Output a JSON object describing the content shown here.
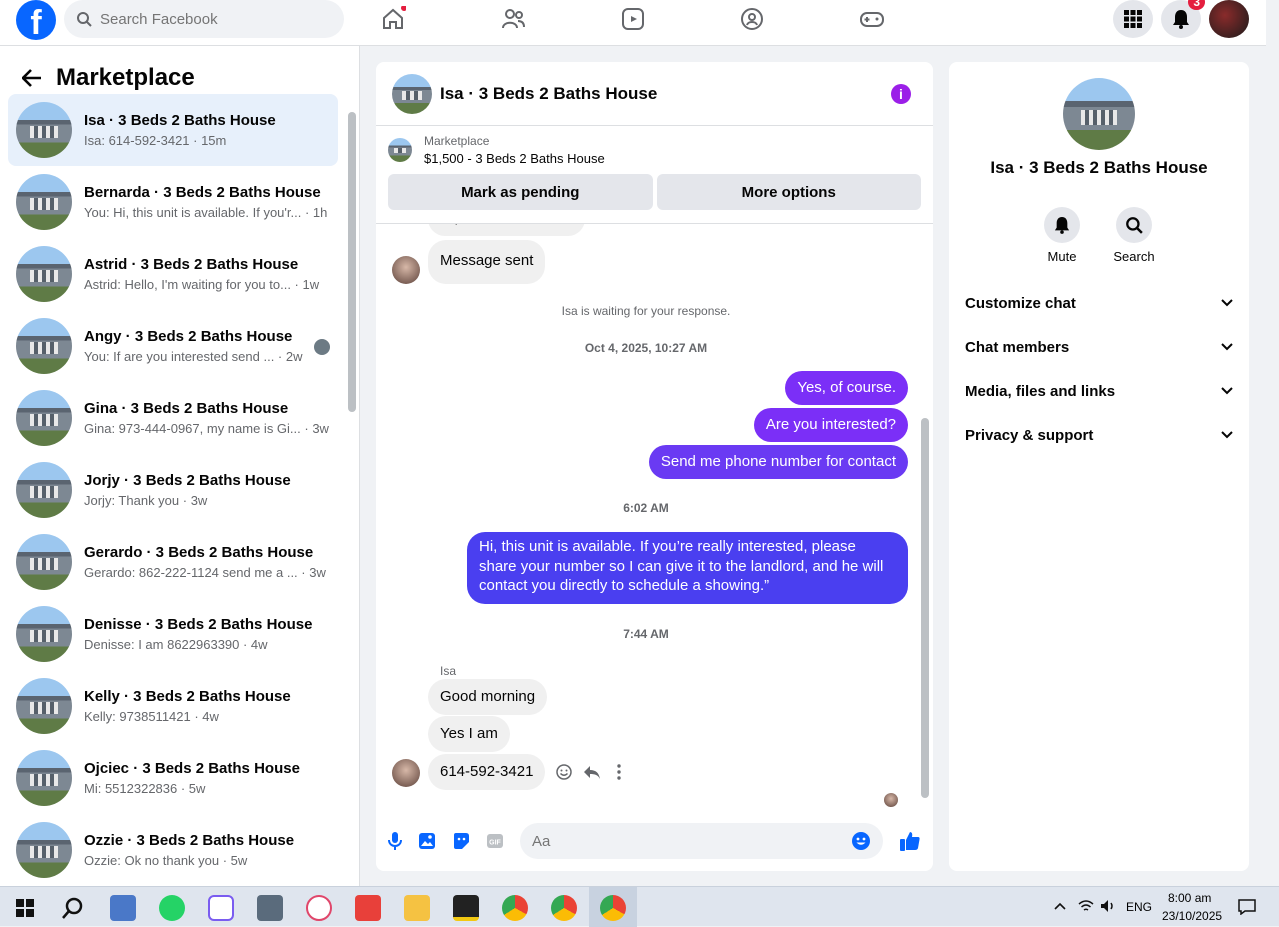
{
  "topbar": {
    "logo": "f",
    "search_placeholder": "Search Facebook",
    "notification_count": "3"
  },
  "sidebar": {
    "title": "Marketplace",
    "conversations": [
      {
        "name": "Isa · 3 Beds 2 Baths House",
        "preview": "Isa: 614-592-3421 · 15m"
      },
      {
        "name": "Bernarda · 3 Beds 2 Baths House",
        "preview": "You: Hi, this unit is available. If you'r... · 1h"
      },
      {
        "name": "Astrid · 3 Beds 2 Baths House",
        "preview": "Astrid: Hello, I'm waiting for you to... · 1w"
      },
      {
        "name": "Angy · 3 Beds 2 Baths House",
        "preview": "You: If are you interested send ... · 2w"
      },
      {
        "name": "Gina · 3 Beds 2 Baths House",
        "preview": "Gina: 973-444-0967, my name is Gi... · 3w"
      },
      {
        "name": "Jorjy · 3 Beds 2 Baths House",
        "preview": "Jorjy: Thank you · 3w"
      },
      {
        "name": "Gerardo · 3 Beds 2 Baths House",
        "preview": "Gerardo: 862-222-1124 send me a ... · 3w"
      },
      {
        "name": "Denisse · 3 Beds 2 Baths House",
        "preview": "Denisse: I am 8622963390 · 4w"
      },
      {
        "name": "Kelly · 3 Beds 2 Baths House",
        "preview": "Kelly: 9738511421 · 4w"
      },
      {
        "name": "Ojciec · 3 Beds 2 Baths House",
        "preview": "Mi: 5512322836 · 5w"
      },
      {
        "name": "Ozzie · 3 Beds 2 Baths House",
        "preview": "Ozzie: Ok no thank you · 5w"
      }
    ]
  },
  "chat": {
    "title": "Isa · 3 Beds 2 Baths House",
    "marketplace_label": "Marketplace",
    "listing": "$1,500 - 3 Beds 2 Baths House",
    "pending_btn": "Mark as pending",
    "options_btn": "More options",
    "cut_msg": "Hi, is this available?",
    "msg_sent": "Message sent",
    "waiting": "Isa is waiting for your response.",
    "time1": "Oct 4, 2025, 10:27 AM",
    "out1": "Yes, of course.",
    "out2": "Are you interested?",
    "out3": "Send me phone number for contact",
    "time2": "6:02 AM",
    "out4": "Hi, this unit is available. If you’re really interested, please share your number so I can give it to the landlord, and he will contact you directly to schedule a showing.”",
    "time3": "7:44 AM",
    "sender": "Isa",
    "in1": "Good morning",
    "in2": "Yes I am",
    "in3": "614-592-3421",
    "composer_placeholder": "Aa"
  },
  "details": {
    "name": "Isa · 3 Beds 2 Baths House",
    "mute": "Mute",
    "search": "Search",
    "sections": [
      "Customize chat",
      "Chat members",
      "Media, files and links",
      "Privacy & support"
    ]
  },
  "taskbar": {
    "lang": "ENG",
    "time": "8:00 am",
    "date": "23/10/2025"
  },
  "colors": {
    "brand": "#0866ff",
    "outgoing_bubble": "#7b2ff7",
    "outgoing_bubble_blue": "#4a3ff0",
    "active_row": "#e7f0fb"
  }
}
